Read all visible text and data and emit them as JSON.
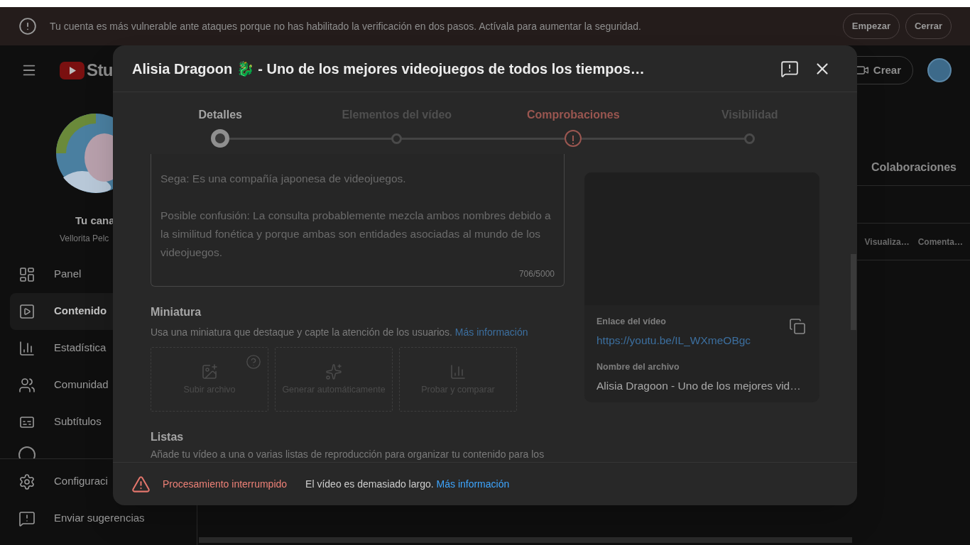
{
  "banner": {
    "message": "Tu cuenta es más vulnerable ante ataques porque no has habilitado la verificación en dos pasos. Actívala para aumentar la seguridad.",
    "buttons": [
      "Empezar",
      "Cerrar"
    ]
  },
  "header": {
    "logo_text": "Stu",
    "create_button": "Crear"
  },
  "sidebar": {
    "channel_title": "Tu cana",
    "channel_name": "Vellorita Pelc",
    "items": [
      {
        "label": "Panel",
        "selected": false
      },
      {
        "label": "Contenido",
        "selected": true
      },
      {
        "label": "Estadística",
        "selected": false
      },
      {
        "label": "Comunidad",
        "selected": false
      },
      {
        "label": "Subtítulos",
        "selected": false
      }
    ],
    "footer_items": [
      "Configuraci",
      "Enviar sugerencias"
    ]
  },
  "content": {
    "tab": "Colaboraciones",
    "columns": [
      "Visualiza…",
      "Comenta…"
    ]
  },
  "dialog": {
    "title": "Alisia Dragoon 🐉 - Uno de los mejores videojuegos de todos los tiempos…",
    "steps": [
      {
        "label": "Detalles",
        "warning": false,
        "selected": true
      },
      {
        "label": "Elementos del vídeo",
        "warning": false,
        "selected": false
      },
      {
        "label": "Comprobaciones",
        "warning": true,
        "selected": false
      },
      {
        "label": "Visibilidad",
        "warning": false,
        "selected": false
      }
    ],
    "description": {
      "paragraphs": [
        "Sega: Es una compañía japonesa de videojuegos.",
        "Posible confusión: La consulta probablemente mezcla ambos nombres debido a la similitud fonética y porque ambas son entidades asociadas al mundo de los videojuegos."
      ],
      "counter": "706/5000"
    },
    "thumbnail": {
      "title": "Miniatura",
      "subtitle": "Usa una miniatura que destaque y capte la atención de los usuarios.",
      "link": "Más información",
      "options": [
        {
          "label": "Subir archivo",
          "help": true
        },
        {
          "label": "Generar automáticamente",
          "help": false
        },
        {
          "label": "Probar y comparar",
          "help": false
        }
      ]
    },
    "playlists": {
      "title": "Listas",
      "subtitle": "Añade tu vídeo a una o varias listas de reproducción para organizar tu contenido para los"
    },
    "video_card": {
      "link_label": "Enlace del vídeo",
      "link": "https://youtu.be/IL_WXmeOBgc",
      "filename_label": "Nombre del archivo",
      "filename": "Alisia Dragoon - Uno de los mejores vid…"
    },
    "footer": {
      "status": "Procesamiento interrumpido",
      "message": "El vídeo es demasiado largo.",
      "link": "Más información"
    }
  }
}
